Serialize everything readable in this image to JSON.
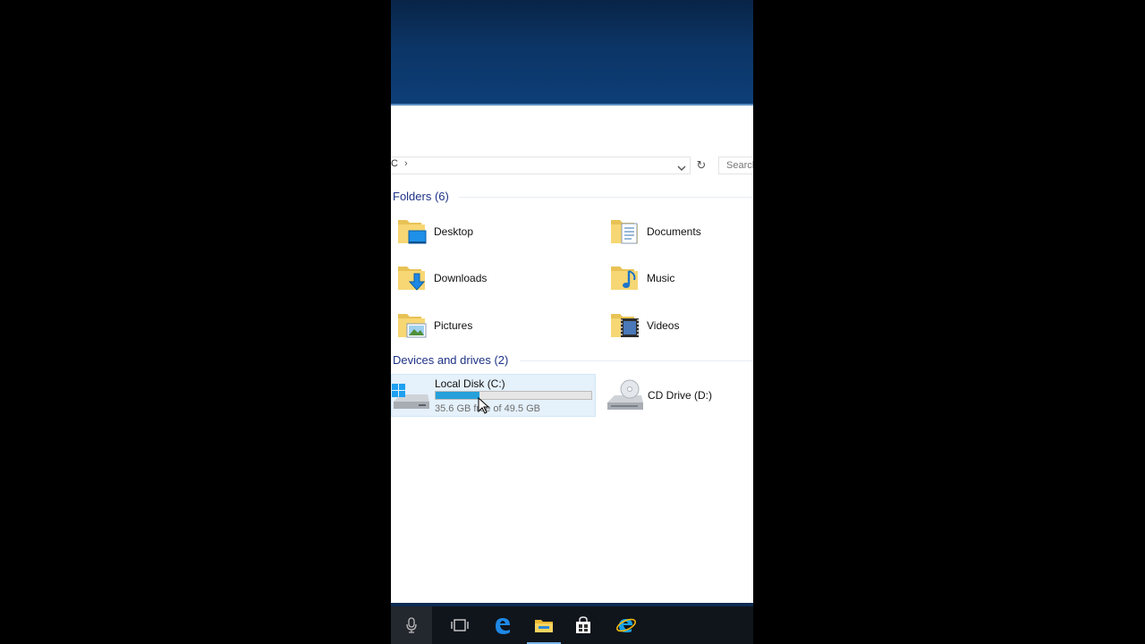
{
  "address": {
    "crumb": "C",
    "separator": "›"
  },
  "search": {
    "placeholder": "Search"
  },
  "folders": {
    "header": "Folders (6)",
    "items": [
      {
        "label": "Desktop",
        "icon": "desktop-folder-icon"
      },
      {
        "label": "Documents",
        "icon": "documents-folder-icon"
      },
      {
        "label": "Downloads",
        "icon": "downloads-folder-icon"
      },
      {
        "label": "Music",
        "icon": "music-folder-icon"
      },
      {
        "label": "Pictures",
        "icon": "pictures-folder-icon"
      },
      {
        "label": "Videos",
        "icon": "videos-folder-icon"
      }
    ]
  },
  "drives": {
    "header": "Devices and drives (2)",
    "local_disk": {
      "name": "Local Disk (C:)",
      "free_text": "35.6 GB free of 49.5 GB",
      "used_fraction": 0.28
    },
    "cd_drive": {
      "name": "CD Drive (D:)"
    }
  },
  "taskbar": {
    "items": [
      "microphone-icon",
      "task-view-icon",
      "edge-icon",
      "file-explorer-icon",
      "store-icon",
      "internet-explorer-icon"
    ]
  },
  "colors": {
    "accent": "#26a0da",
    "header_text": "#1e3287",
    "selection_bg": "#e5f1fb",
    "taskbar": "#10151c"
  }
}
